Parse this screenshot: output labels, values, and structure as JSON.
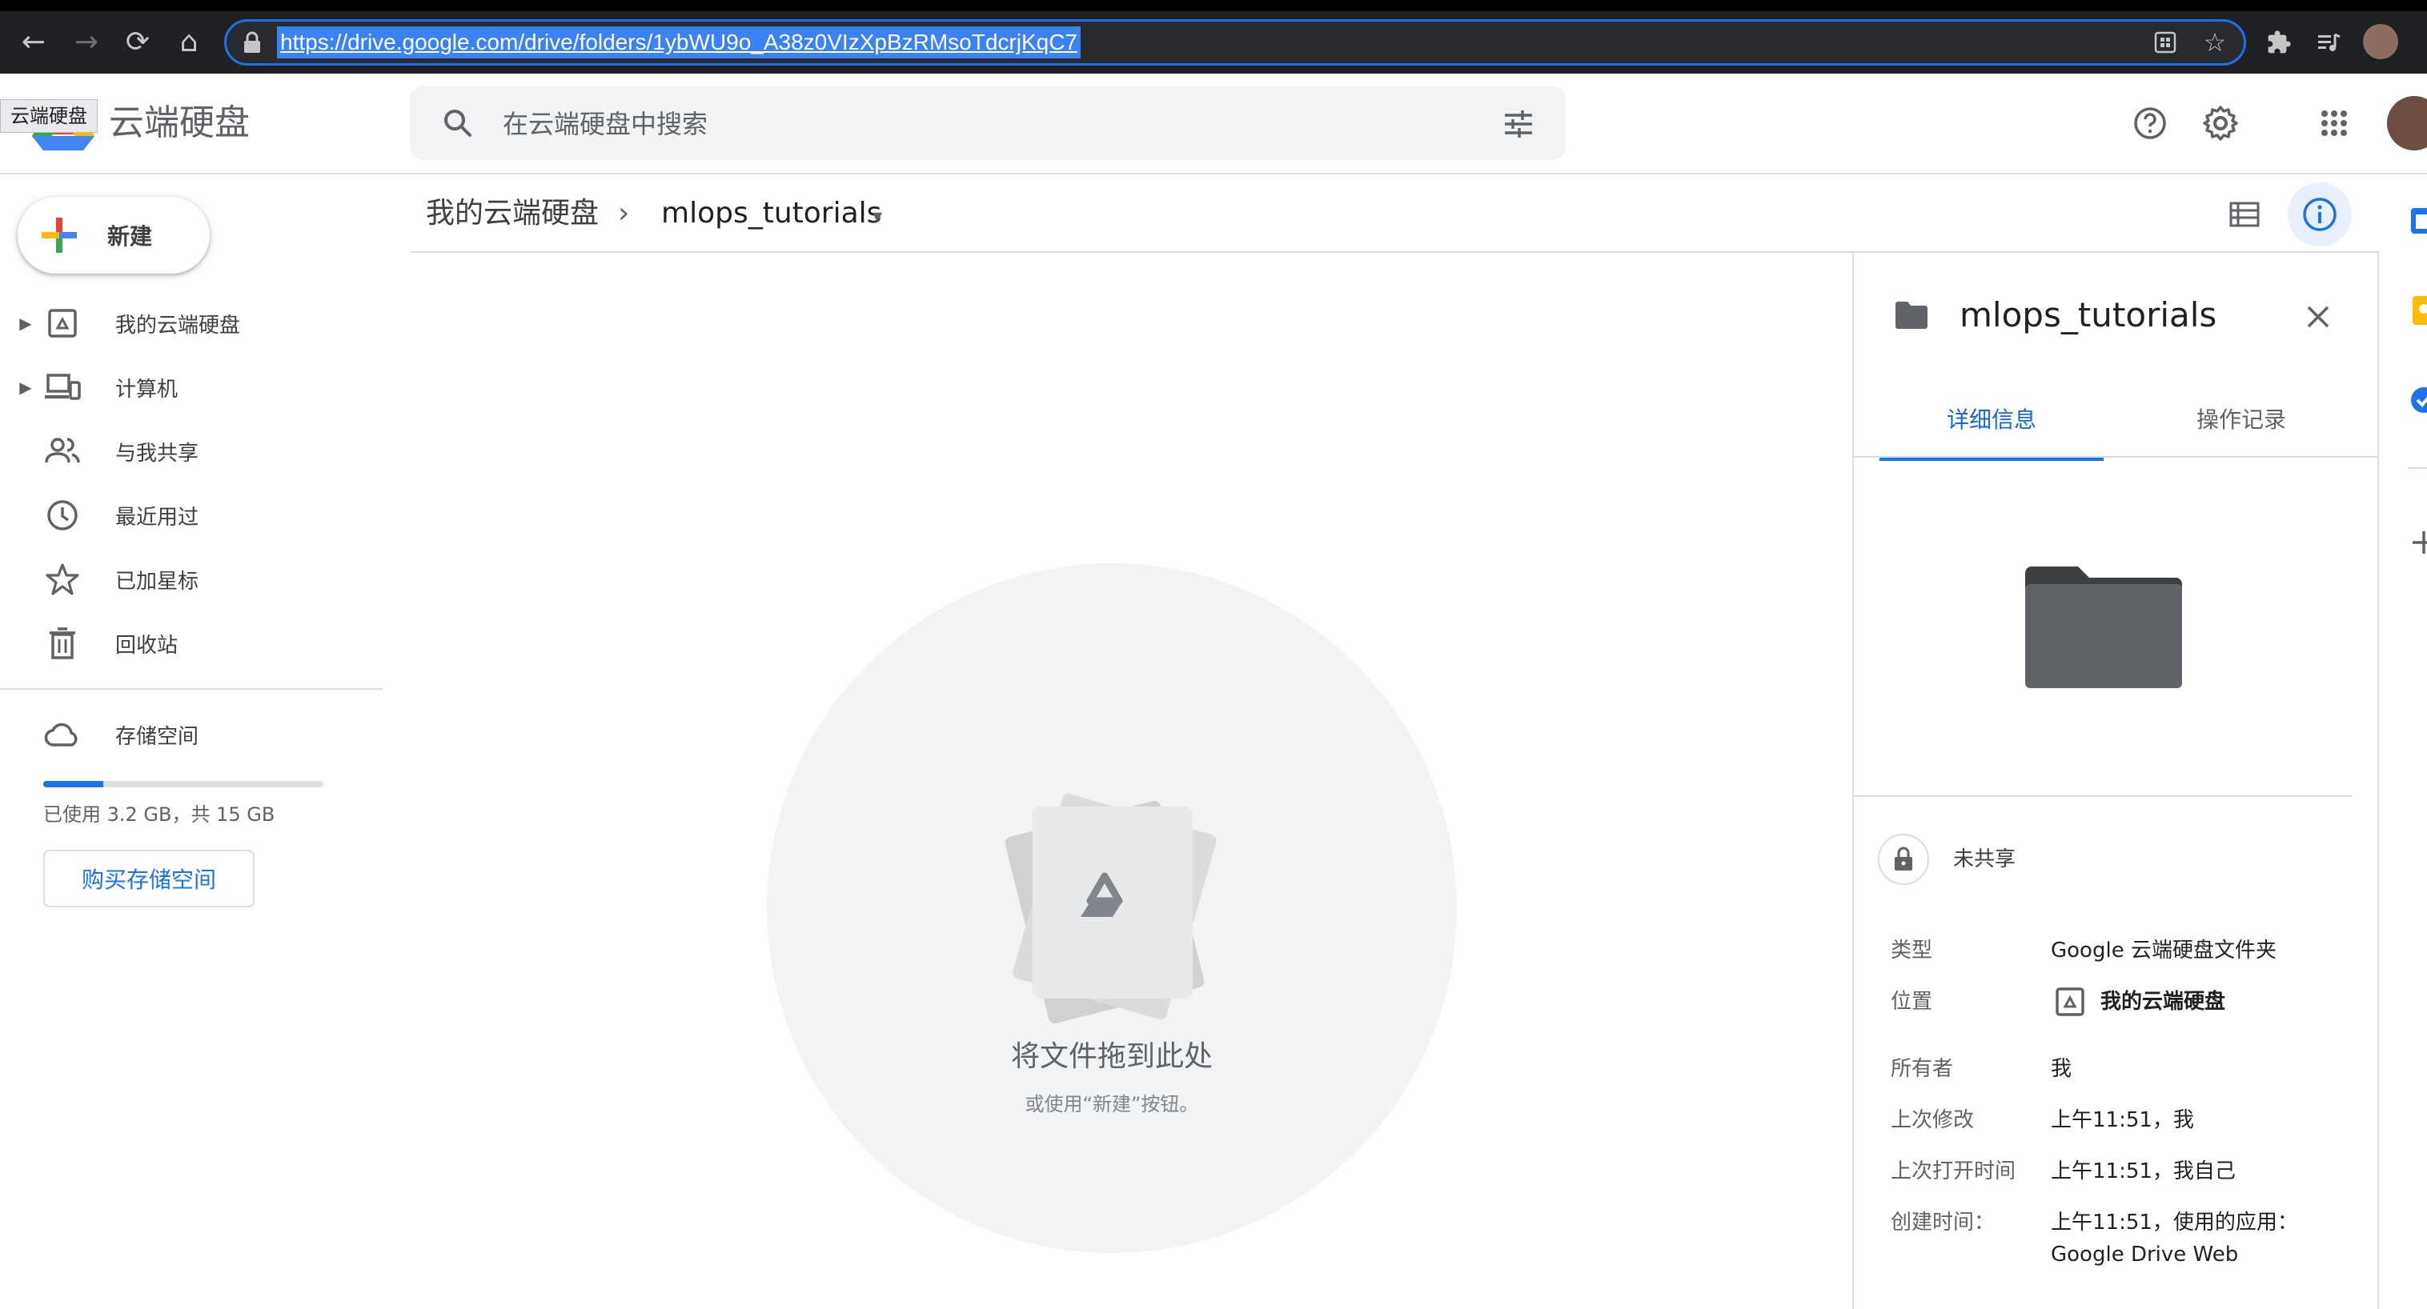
{
  "browser": {
    "url": "https://drive.google.com/drive/folders/1ybWU9o_A38z0VIzXpBzRMsoTdcrjKqC7"
  },
  "app": {
    "name": "云端硬盘",
    "logo_tooltip": "云端硬盘"
  },
  "search": {
    "placeholder": "在云端硬盘中搜索"
  },
  "sidebar": {
    "new_label": "新建",
    "items": [
      {
        "label": "我的云端硬盘",
        "icon": "drive-icon"
      },
      {
        "label": "计算机",
        "icon": "computers-icon"
      },
      {
        "label": "与我共享",
        "icon": "shared-icon"
      },
      {
        "label": "最近用过",
        "icon": "clock-icon"
      },
      {
        "label": "已加星标",
        "icon": "star-icon"
      },
      {
        "label": "回收站",
        "icon": "trash-icon"
      }
    ],
    "storage": {
      "label": "存储空间",
      "used_text": "已使用 3.2 GB，共 15 GB",
      "used_fraction": 0.213,
      "buy_label": "购买存储空间"
    }
  },
  "breadcrumb": {
    "root": "我的云端硬盘",
    "separator": "›",
    "current": "mlops_tutorials",
    "dropdown": "▾"
  },
  "main": {
    "empty_title": "将文件拖到此处",
    "empty_subtitle": "或使用“新建”按钮。"
  },
  "details": {
    "title": "mlops_tutorials",
    "tabs": [
      "详细信息",
      "操作记录"
    ],
    "active_tab": 0,
    "share_status": "未共享",
    "properties": [
      {
        "key": "类型",
        "value": "Google 云端硬盘文件夹"
      },
      {
        "key": "位置",
        "value": "我的云端硬盘"
      },
      {
        "key": "所有者",
        "value": "我"
      },
      {
        "key": "上次修改",
        "value": "上午11:51，我"
      },
      {
        "key": "上次打开时间",
        "value": "上午11:51，我自己"
      },
      {
        "key": "创建时间：",
        "value": "上午11:51，使用的应用：",
        "value2": "Google Drive Web"
      }
    ]
  },
  "colors": {
    "accent": "#1a73e8",
    "chrome_bg": "#202124",
    "folder_dark": "#5f6368"
  }
}
